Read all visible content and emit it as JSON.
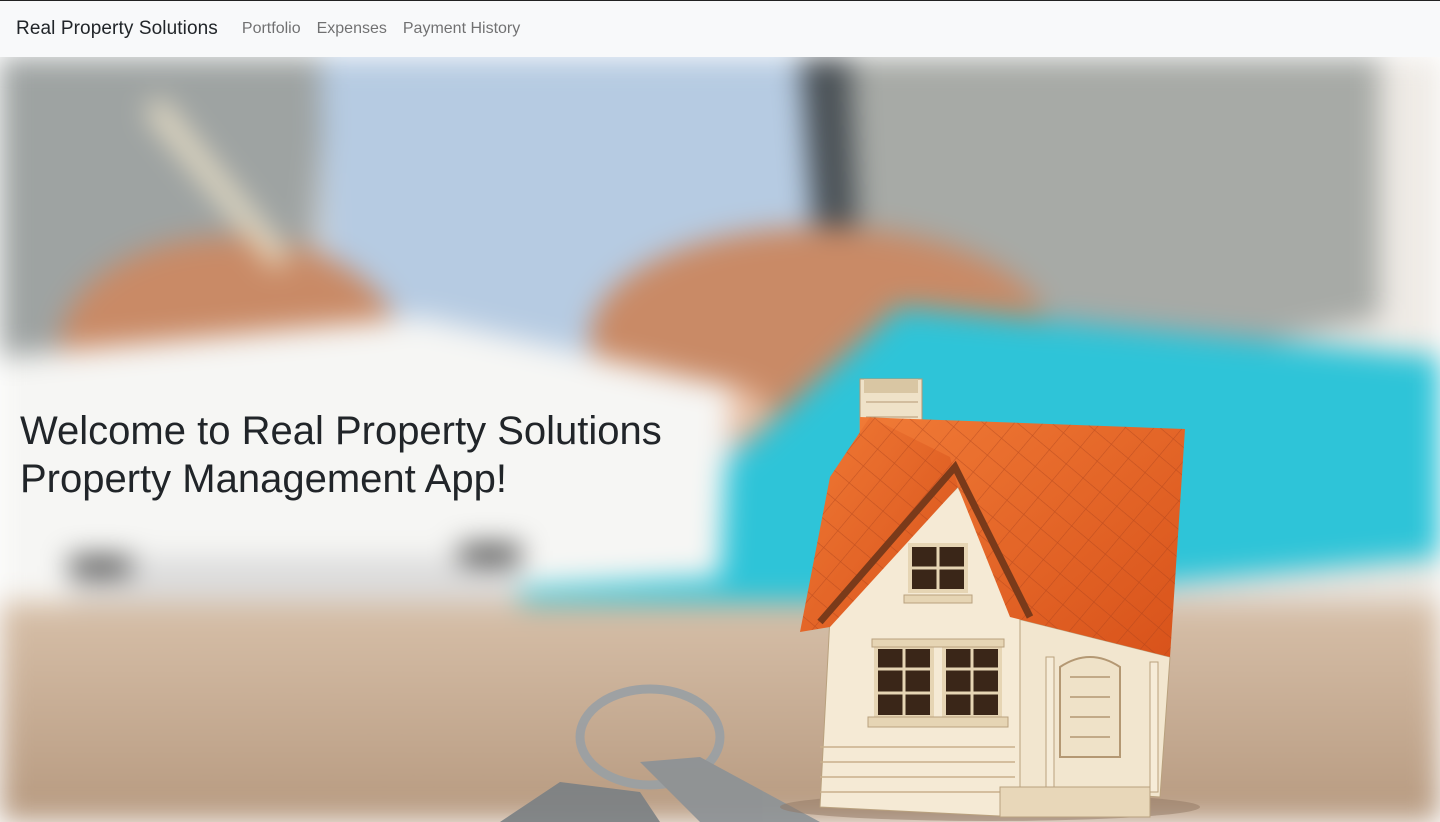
{
  "navbar": {
    "brand": "Real Property Solutions",
    "links": [
      {
        "label": "Portfolio"
      },
      {
        "label": "Expenses"
      },
      {
        "label": "Payment History"
      }
    ]
  },
  "hero": {
    "heading_line1": "Welcome to Real Property Solutions",
    "heading_line2": "Property Management App!"
  },
  "colors": {
    "navbar_bg": "#f8f9fa",
    "heading": "#212529",
    "nav_link": "#6c757d",
    "folder_cyan": "#2ec4d8",
    "roof_orange": "#e8601f",
    "house_body": "#f3e7cf",
    "table_wood": "#c9ad93"
  },
  "icons": [
    "hero-background-image",
    "house-model-image",
    "keys-image"
  ]
}
